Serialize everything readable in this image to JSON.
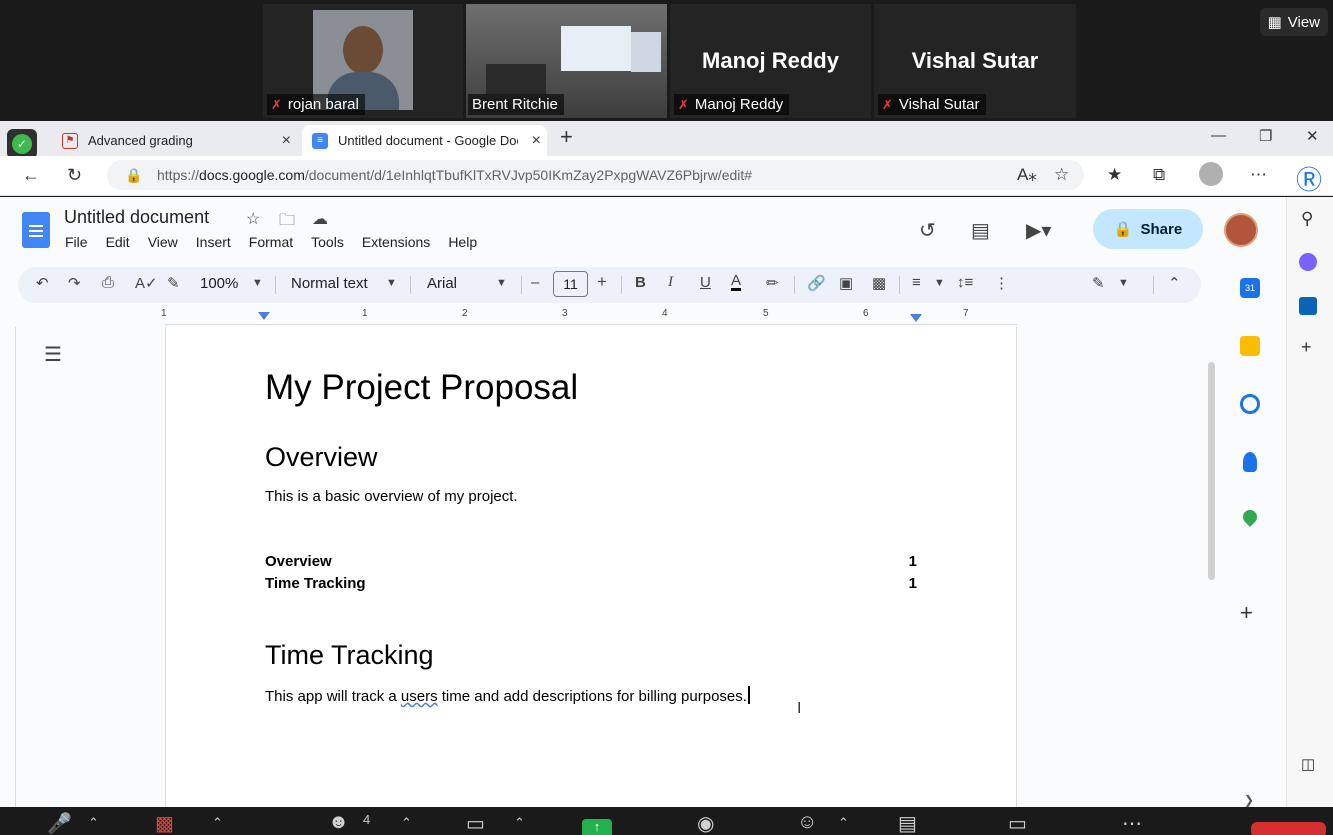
{
  "zoom": {
    "participants": [
      {
        "name": "rojan baral"
      },
      {
        "name": "Brent Ritchie"
      },
      {
        "name": "Manoj Reddy"
      },
      {
        "name": "Vishal Sutar"
      }
    ],
    "view_label": "View",
    "participants_count": "4"
  },
  "browser": {
    "tabs": [
      {
        "label": "Advanced grading"
      },
      {
        "label": "Untitled document - Google Doc"
      }
    ],
    "url_scheme": "https://",
    "url_host": "docs.google.com",
    "url_path": "/document/d/1eInhlqtTbufKlTxRVJvp50IKmZay2PxpgWAVZ6Pbjrw/edit#"
  },
  "docs": {
    "doc_title": "Untitled document",
    "menu": [
      "File",
      "Edit",
      "View",
      "Insert",
      "Format",
      "Tools",
      "Extensions",
      "Help"
    ],
    "share_label": "Share",
    "toolbar": {
      "zoom": "100%",
      "style": "Normal text",
      "font": "Arial",
      "font_size": "11"
    },
    "ruler": [
      "1",
      "1",
      "2",
      "3",
      "4",
      "5",
      "6",
      "7"
    ],
    "content": {
      "title": "My Project Proposal",
      "h1_overview": "Overview",
      "p_overview": "This is a basic overview of my project.",
      "toc": [
        {
          "label": "Overview",
          "page": "1"
        },
        {
          "label": "Time Tracking",
          "page": "1"
        }
      ],
      "h1_time": "Time Tracking",
      "p_time_before": "This app will track a ",
      "p_time_word": "users",
      "p_time_after": " time and add descriptions for billing purposes."
    }
  },
  "colors": {
    "accent": "#4285f4",
    "share_bg": "#c2e7ff",
    "mic_off": "#e0423c"
  }
}
